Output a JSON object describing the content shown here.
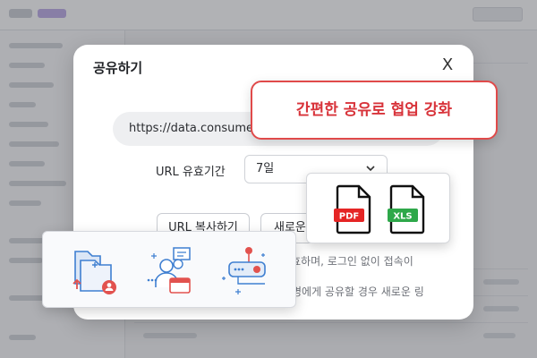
{
  "modal": {
    "title": "공유하기",
    "close_label": "X",
    "url_value": "https://data.consume",
    "expiry_label": "URL 유효기간",
    "expiry_value": "7일",
    "copy_button": "URL 복사하기",
    "new_button": "새로운 U",
    "note_line1": "유효하며, 로그인 없이 접속이",
    "note_line2": "명에게 공유할 경우 새로운 링"
  },
  "callout": {
    "text": "간편한 공유로 협업 강화"
  },
  "file_formats": {
    "pdf_label": "PDF",
    "xls_label": "XLS"
  },
  "colors": {
    "accent_red": "#e04a4a",
    "pdf_red": "#e52525",
    "xls_green": "#2ea84a",
    "icon_blue": "#3f7fd1",
    "icon_red": "#e2524e"
  },
  "icons": [
    "folder-share-icon",
    "user-message-icon",
    "server-link-icon",
    "chevron-down-icon",
    "pdf-file-icon",
    "xls-file-icon"
  ]
}
